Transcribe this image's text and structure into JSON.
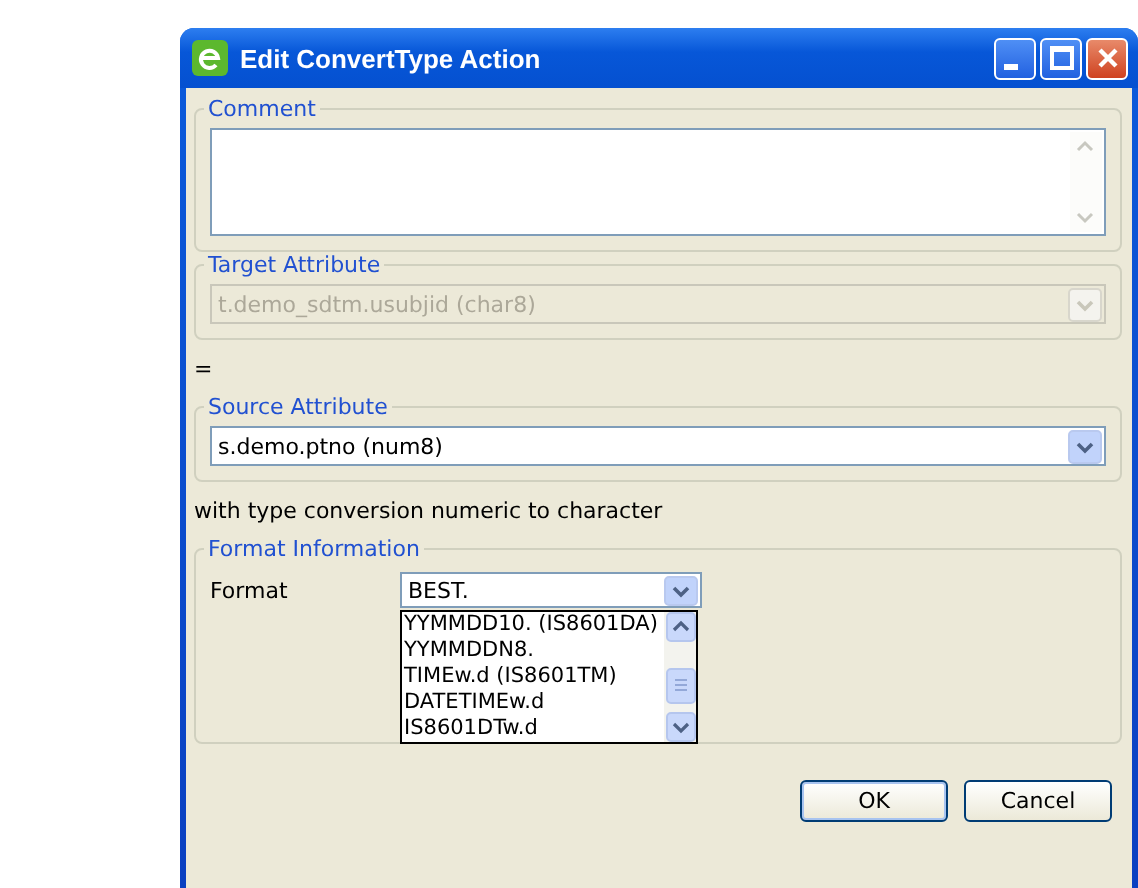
{
  "window": {
    "title": "Edit ConvertType Action"
  },
  "comment": {
    "label": "Comment"
  },
  "target_attribute": {
    "label": "Target Attribute",
    "value": "t.demo_sdtm.usubjid (char8)",
    "disabled": true
  },
  "equals_text": "=",
  "source_attribute": {
    "label": "Source Attribute",
    "value": "s.demo.ptno (num8)",
    "disabled": false
  },
  "conversion_text": "with type conversion numeric to character",
  "format_information": {
    "label": "Format Information",
    "format_label": "Format",
    "value": "BEST.",
    "expanded": true,
    "options": [
      "YYMMDD10. (IS8601DA)",
      "YYMMDDN8.",
      "TIMEw.d (IS8601TM)",
      "DATETIMEw.d",
      "IS8601DTw.d"
    ]
  },
  "buttons": [
    "OK",
    "Cancel"
  ]
}
